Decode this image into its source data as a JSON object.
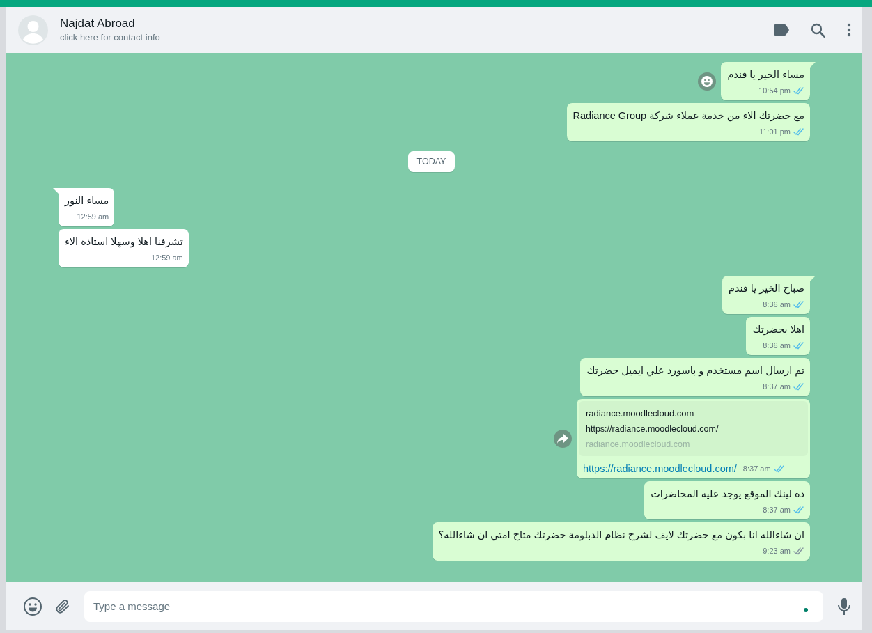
{
  "header": {
    "name": "Najdat Abroad",
    "subtitle": "click here for contact info"
  },
  "messages": [
    {
      "kind": "out",
      "text": "مساء الخير يا فندم",
      "time": "10:54 pm",
      "read": true,
      "tail": true,
      "reaction_button": true
    },
    {
      "kind": "out",
      "text": "مع حضرتك الاء من خدمة عملاء شركة Radiance Group",
      "time": "11:01 pm",
      "read": true,
      "tail": false
    },
    {
      "kind": "date",
      "text": "TODAY"
    },
    {
      "kind": "in",
      "text": "مساء النور",
      "time": "12:59 am",
      "tail": true
    },
    {
      "kind": "in",
      "text": "تشرفنا اهلا وسهلا استاذة الاء",
      "time": "12:59 am",
      "tail": false
    },
    {
      "kind": "out",
      "text": "صباح الخير يا فندم",
      "time": "8:36 am",
      "read": true,
      "tail": true
    },
    {
      "kind": "out",
      "text": "اهلا بحضرتك",
      "time": "8:36 am",
      "read": true,
      "tail": false
    },
    {
      "kind": "out",
      "text": "تم ارسال اسم مستخدم و باسورد علي ايميل حضرتك",
      "time": "8:37 am",
      "read": true,
      "tail": false
    },
    {
      "kind": "link",
      "preview_title": "radiance.moodlecloud.com",
      "preview_description": "https://radiance.moodlecloud.com/",
      "preview_site": "radiance.moodlecloud.com",
      "text": "https://radiance.moodlecloud.com/",
      "time": "8:37 am",
      "read": true,
      "tail": false,
      "forward_button": true
    },
    {
      "kind": "out",
      "text": "ده لينك الموقع يوجد عليه المحاضرات",
      "time": "8:37 am",
      "read": true,
      "tail": false
    },
    {
      "kind": "out",
      "text": "ان شاءالله انا بكون مع حضرتك لايف لشرح نظام الدبلومة حضرتك متاح امتي ان شاءالله؟",
      "time": "9:23 am",
      "read": false,
      "tail": false
    }
  ],
  "composer": {
    "placeholder": "Type a message"
  }
}
